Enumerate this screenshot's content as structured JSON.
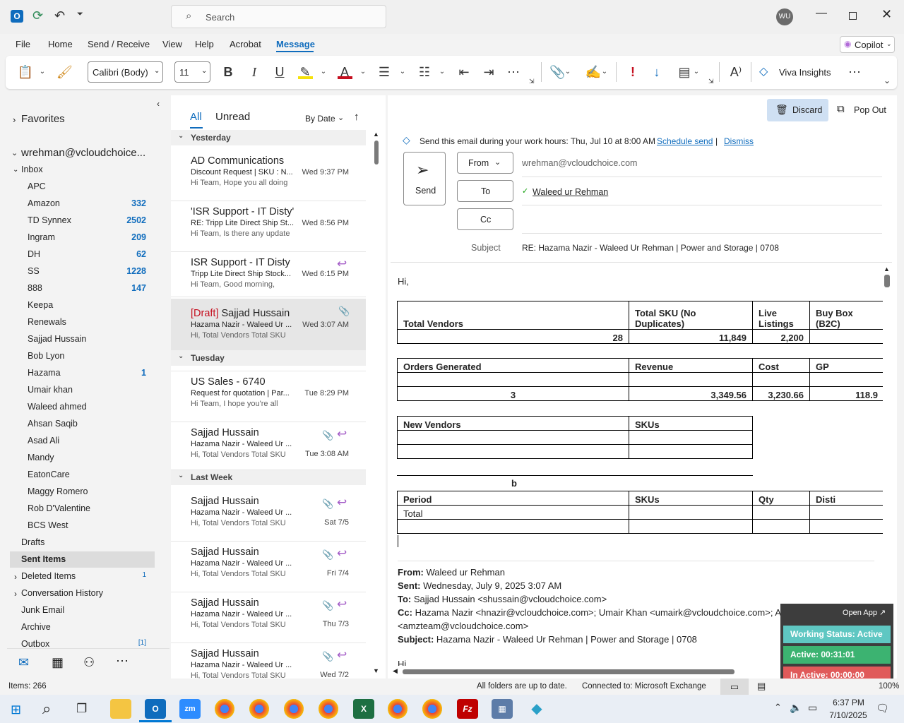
{
  "titlebar": {
    "search_placeholder": "Search",
    "avatar": "WU"
  },
  "menu": {
    "items": [
      "File",
      "Home",
      "Send / Receive",
      "View",
      "Help",
      "Acrobat",
      "Message"
    ],
    "active": "Message",
    "copilot": "Copilot"
  },
  "ribbon": {
    "font_name": "Calibri (Body)",
    "font_size": "11",
    "viva": "Viva Insights"
  },
  "folders": {
    "favorites": "Favorites",
    "account": "wrehman@vcloudchoice...",
    "inbox": "Inbox",
    "subfolders": [
      {
        "name": "APC",
        "count": ""
      },
      {
        "name": "Amazon",
        "count": "332"
      },
      {
        "name": "TD Synnex",
        "count": "2502"
      },
      {
        "name": "Ingram",
        "count": "209"
      },
      {
        "name": "DH",
        "count": "62"
      },
      {
        "name": "SS",
        "count": "1228"
      },
      {
        "name": "888",
        "count": "147"
      },
      {
        "name": "Keepa",
        "count": ""
      },
      {
        "name": "Renewals",
        "count": ""
      },
      {
        "name": "Sajjad Hussain",
        "count": ""
      },
      {
        "name": "Bob Lyon",
        "count": ""
      },
      {
        "name": "Hazama",
        "count": "1"
      },
      {
        "name": "Umair khan",
        "count": ""
      },
      {
        "name": "Waleed ahmed",
        "count": ""
      },
      {
        "name": "Ahsan Saqib",
        "count": ""
      },
      {
        "name": "Asad Ali",
        "count": ""
      },
      {
        "name": "Mandy",
        "count": ""
      },
      {
        "name": "EatonCare",
        "count": ""
      },
      {
        "name": "Maggy Romero",
        "count": ""
      },
      {
        "name": "Rob D'Valentine",
        "count": ""
      },
      {
        "name": "BCS West",
        "count": ""
      }
    ],
    "top": [
      {
        "name": "Drafts",
        "count": ""
      },
      {
        "name": "Sent Items",
        "count": ""
      },
      {
        "name": "Deleted Items",
        "count": "1"
      },
      {
        "name": "Conversation History",
        "count": ""
      },
      {
        "name": "Junk Email",
        "count": ""
      },
      {
        "name": "Archive",
        "count": ""
      },
      {
        "name": "Outbox",
        "count": "[1]"
      }
    ]
  },
  "list": {
    "tab_all": "All",
    "tab_unread": "Unread",
    "sort": "By Date",
    "groups": {
      "yesterday": "Yesterday",
      "tuesday": "Tuesday",
      "lastweek": "Last Week"
    },
    "messages": [
      {
        "draft": "",
        "from": "AD Communications",
        "subject": "Discount Request | SKU : N...",
        "date": "Wed 9:37 PM",
        "preview": "Hi Team,  Hope you all doing"
      },
      {
        "draft": "",
        "from": "'ISR Support - IT Disty'",
        "subject": "RE: Tripp Lite Direct Ship St...",
        "date": "Wed 8:56 PM",
        "preview": "Hi Team,  Is there any update"
      },
      {
        "draft": "",
        "from": "ISR Support - IT Disty",
        "subject": "Tripp Lite Direct Ship Stock...",
        "date": "Wed 6:15 PM",
        "preview": "Hi Team,  Good morning,"
      },
      {
        "draft": "[Draft]",
        "from": "Sajjad Hussain",
        "subject": "Hazama Nazir - Waleed Ur ...",
        "date": "Wed 3:07 AM",
        "preview": "Hi,  Total Vendors  Total SKU"
      },
      {
        "draft": "",
        "from": "US Sales - 6740",
        "subject": "Request for quotation | Par...",
        "date": "Tue 8:29 PM",
        "preview": "Hi Team,  I hope you're all"
      },
      {
        "draft": "",
        "from": "Sajjad Hussain",
        "subject": "Hazama Nazir - Waleed Ur ...",
        "date": "Tue 3:08 AM",
        "preview": "Hi,  Total Vendors  Total SKU"
      },
      {
        "draft": "",
        "from": "Sajjad Hussain",
        "subject": "Hazama Nazir - Waleed Ur ...",
        "date": "Sat 7/5",
        "preview": "Hi,  Total Vendors  Total SKU"
      },
      {
        "draft": "",
        "from": "Sajjad Hussain",
        "subject": "Hazama Nazir - Waleed Ur ...",
        "date": "Fri 7/4",
        "preview": "Hi,  Total Vendors  Total SKU"
      },
      {
        "draft": "",
        "from": "Sajjad Hussain",
        "subject": "Hazama Nazir - Waleed Ur ...",
        "date": "Thu 7/3",
        "preview": "Hi,  Total Vendors  Total SKU"
      },
      {
        "draft": "",
        "from": "Sajjad Hussain",
        "subject": "Hazama Nazir - Waleed Ur ...",
        "date": "Wed 7/2",
        "preview": "Hi,  Total Vendors  Total SKU"
      }
    ]
  },
  "compose": {
    "discard": "Discard",
    "popout": "Pop Out",
    "banner": "Send this email during your work hours: Thu, Jul 10 at 8:00 AM",
    "schedule": "Schedule send",
    "bar": "|",
    "dismiss": "Dismiss",
    "send": "Send",
    "from_btn": "From",
    "to_btn": "To",
    "cc_btn": "Cc",
    "from_value": "wrehman@vcloudchoice.com",
    "to_value": "Waleed ur Rehman",
    "subject_label": "Subject",
    "subject_value": "RE: Hazama Nazir - Waleed Ur Rehman | Power and Storage | 0708",
    "greeting": "Hi,",
    "t1": {
      "h": [
        "Total Vendors",
        "Total SKU (No Duplicates)",
        "Live\nListings",
        "Buy Box (B2C)"
      ],
      "v": [
        "28",
        "11,849",
        "2,200",
        ""
      ]
    },
    "t2": {
      "h": [
        "Orders Generated",
        "Revenue",
        "Cost",
        "GP"
      ],
      "v": [
        "3",
        "3,349.56",
        "3,230.66",
        "118.9"
      ]
    },
    "t3": {
      "h": [
        "New Vendors",
        "SKUs"
      ]
    },
    "t4": {
      "title": "b",
      "h": [
        "Period",
        "SKUs",
        "Qty",
        "Disti"
      ],
      "total": "Total"
    },
    "quote": {
      "from_l": "From:",
      "from": " Waleed ur Rehman",
      "sent_l": "Sent:",
      "sent": " Wednesday, July 9, 2025 3:07 AM",
      "to_l": "To:",
      "to": " Sajjad Hussain <shussain@vcloudchoice.com>",
      "cc_l": "Cc:",
      "cc": " Hazama Nazir <hnazir@vcloudchoice.com>; Umair Khan <umairk@vcloudchoice.com>; Amazon Team",
      "cc2": "<amzteam@vcloudchoice.com>",
      "subj_l": "Subject:",
      "subj": " Hazama Nazir - Waleed Ur Rehman | Power and Storage | 0708",
      "hi": "Hi"
    }
  },
  "widget": {
    "open": "Open App",
    "status": "Working Status: Active",
    "active": "Active: 00:31:01",
    "inactive": "In Active: 00:00:00"
  },
  "status": {
    "items": "Items: 266",
    "sync": "All folders are up to date.",
    "conn": "Connected to: Microsoft Exchange",
    "zoom": "100%"
  },
  "taskbar": {
    "time": "6:37 PM",
    "date": "7/10/2025"
  },
  "colors": {
    "accent": "#0f6cbd",
    "draft": "#c50f1f",
    "widget_teal": "#5fc7c2",
    "widget_green": "#3cb371",
    "widget_red": "#e05a5a"
  }
}
